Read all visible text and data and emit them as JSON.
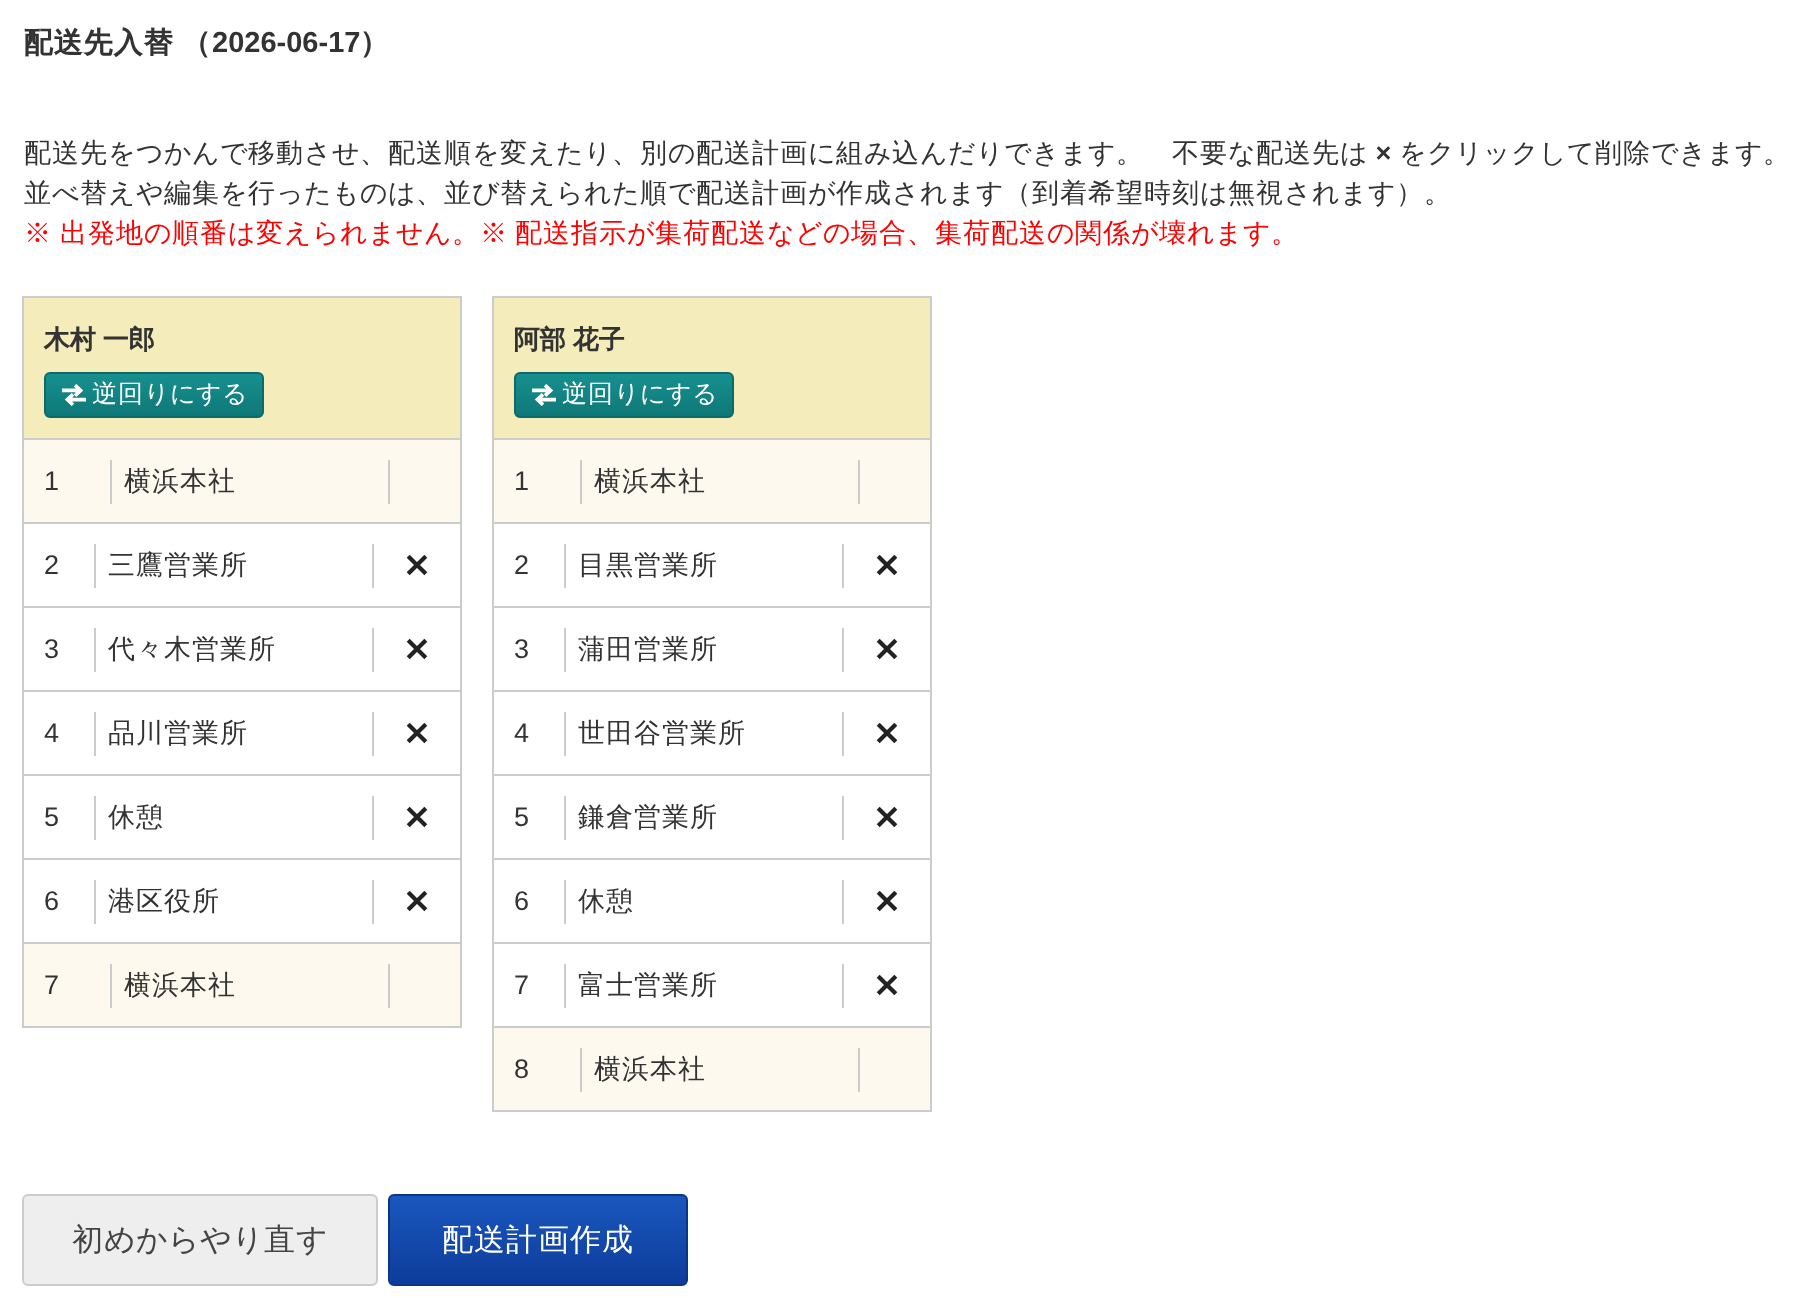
{
  "title": "配送先入替 （2026-06-17）",
  "notes": [
    {
      "kind": "info",
      "parts": [
        "配送先をつかんで移動させ、配送順を変えたり、別の配送計画に組み込んだりできます。",
        "不要な配送先は **×** をクリックして削除できます。"
      ]
    },
    {
      "kind": "info",
      "parts": [
        "並べ替えや編集を行ったものは、並び替えられた順で配送計画が作成されます（到着希望時刻は無視されます）。"
      ]
    },
    {
      "kind": "warning",
      "parts": [
        "※ 出発地の順番は変えられません。※ 配送指示が集荷配送などの場合、集荷配送の関係が壊れます。"
      ]
    }
  ],
  "routes": [
    {
      "driver": "木村 一郎",
      "reverse_button": "逆回りにする",
      "stops": [
        {
          "kind": "fixed",
          "number": "1",
          "name": "横浜本社"
        },
        {
          "kind": "stop",
          "number": "2",
          "name": "三鷹営業所"
        },
        {
          "kind": "stop",
          "number": "3",
          "name": "代々木営業所"
        },
        {
          "kind": "stop",
          "number": "4",
          "name": "品川営業所"
        },
        {
          "kind": "stop",
          "number": "5",
          "name": "休憩"
        },
        {
          "kind": "stop",
          "number": "6",
          "name": "港区役所"
        },
        {
          "kind": "fixed",
          "number": "7",
          "name": "横浜本社"
        }
      ]
    },
    {
      "driver": "阿部 花子",
      "reverse_button": "逆回りにする",
      "stops": [
        {
          "kind": "fixed",
          "number": "1",
          "name": "横浜本社"
        },
        {
          "kind": "stop",
          "number": "2",
          "name": "目黒営業所"
        },
        {
          "kind": "stop",
          "number": "3",
          "name": "蒲田営業所"
        },
        {
          "kind": "stop",
          "number": "4",
          "name": "世田谷営業所"
        },
        {
          "kind": "stop",
          "number": "5",
          "name": "鎌倉営業所"
        },
        {
          "kind": "stop",
          "number": "6",
          "name": "休憩"
        },
        {
          "kind": "stop",
          "number": "7",
          "name": "富士営業所"
        },
        {
          "kind": "fixed",
          "number": "8",
          "name": "横浜本社"
        }
      ]
    }
  ],
  "buttons": [
    {
      "kind": "secondary",
      "label": "初めからやり直す"
    },
    {
      "kind": "primary",
      "label": "配送計画作成"
    }
  ]
}
